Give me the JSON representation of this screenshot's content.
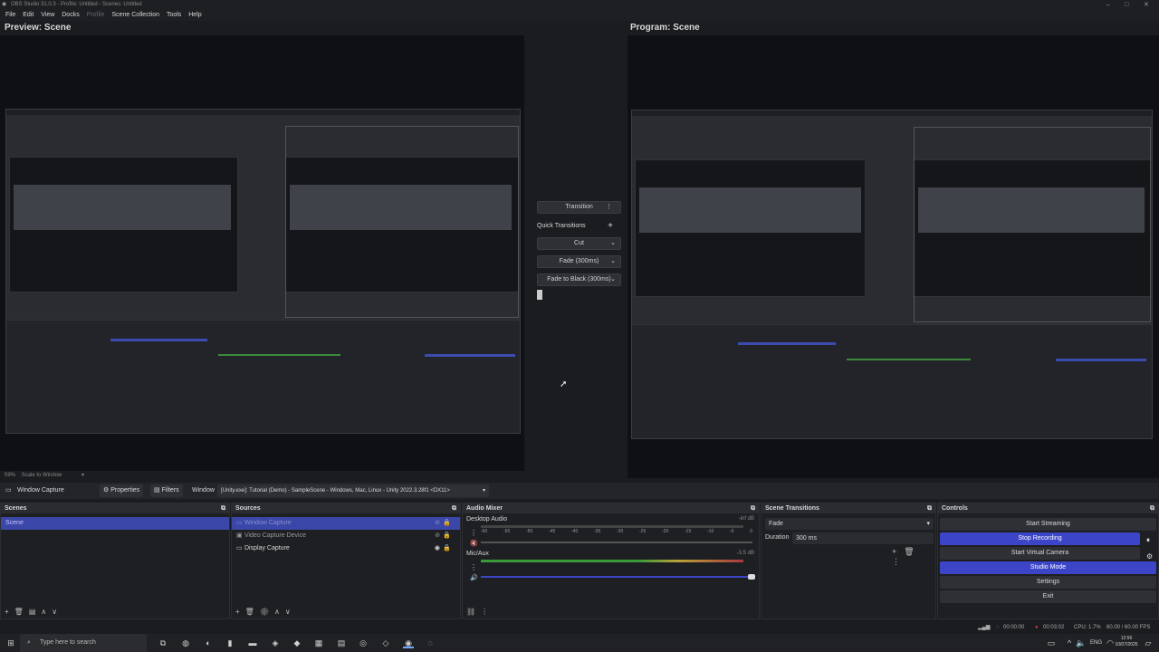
{
  "window": {
    "title": "OBS Studio 31.0.3 - Profile: Untitled - Scenes: Untitled"
  },
  "menu": [
    {
      "label": "File"
    },
    {
      "label": "Edit"
    },
    {
      "label": "View"
    },
    {
      "label": "Docks"
    },
    {
      "label": "Profile",
      "disabled": true
    },
    {
      "label": "Scene Collection"
    },
    {
      "label": "Tools"
    },
    {
      "label": "Help"
    }
  ],
  "preview": {
    "title": "Preview: Scene",
    "zoom": "59%",
    "scale_mode": "Scale to Window"
  },
  "program": {
    "title": "Program: Scene"
  },
  "transition_panel": {
    "transition_label": "Transition",
    "quick_transitions_label": "Quick Transitions",
    "quick_items": [
      "Cut",
      "Fade (300ms)",
      "Fade to Black (300ms)"
    ]
  },
  "source_toolbar": {
    "source_name": "Window Capture",
    "properties": "Properties",
    "filters": "Filters",
    "window_label": "Window",
    "window_value": "[Unity.exe]: Tutorial (Demo) - SampleScene - Windows, Mac, Linux - Unity 2022.3.28f1 <DX11>"
  },
  "scenes": {
    "title": "Scenes",
    "items": [
      "Scene"
    ]
  },
  "sources": {
    "title": "Sources",
    "items": [
      "Window Capture",
      "Video Capture Device",
      "Display Capture"
    ]
  },
  "audio_mixer": {
    "title": "Audio Mixer",
    "channels": [
      {
        "name": "Desktop Audio",
        "db": "-inf dB"
      },
      {
        "name": "Mic/Aux",
        "db": "-3.5 dB"
      }
    ],
    "ticks": [
      "-60",
      "-55",
      "-50",
      "-45",
      "-40",
      "-35",
      "-30",
      "-25",
      "-20",
      "-15",
      "-10",
      "-5",
      "0"
    ]
  },
  "scene_transitions": {
    "title": "Scene Transitions",
    "type": "Fade",
    "duration_label": "Duration",
    "duration_value": "300 ms"
  },
  "controls": {
    "title": "Controls",
    "start_streaming": "Start Streaming",
    "stop_recording": "Stop Recording",
    "start_virtual_camera": "Start Virtual Camera",
    "studio_mode": "Studio Mode",
    "settings": "Settings",
    "exit": "Exit"
  },
  "status": {
    "stream_time": "00:00:00",
    "rec_time": "00:03:02",
    "cpu": "CPU: 1.7%",
    "fps": "60.00 / 60.00 FPS"
  },
  "taskbar": {
    "search_placeholder": "Type here to search",
    "lang": "ENG",
    "time": "12:56",
    "date": "10/07/2025"
  },
  "colors": {
    "accent": "#3c45c8",
    "background": "#1b1c20",
    "panel": "#1e1f23",
    "record": "#d43b3b"
  }
}
